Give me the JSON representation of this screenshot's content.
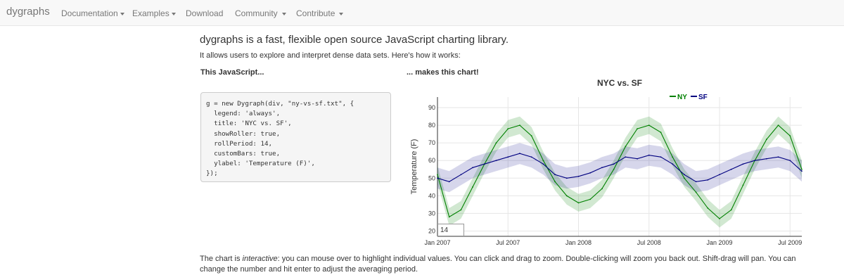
{
  "nav": {
    "brand": "dygraphs",
    "items": [
      {
        "label": "Documentation",
        "caret": true
      },
      {
        "label": "Examples",
        "caret": true
      },
      {
        "label": "Download",
        "caret": false
      },
      {
        "label": "Community",
        "caret": true
      },
      {
        "label": "Contribute",
        "caret": true
      }
    ]
  },
  "content": {
    "intro": "dygraphs is a fast, flexible open source JavaScript charting library.",
    "lead": "It allows users to explore and interpret dense data sets. Here's how it works:",
    "left_heading": "This JavaScript...",
    "right_heading": "... makes this chart!",
    "code": "g = new Dygraph(div, \"ny-vs-sf.txt\", {\n  legend: 'always',\n  title: 'NYC vs. SF',\n  showRoller: true,\n  rollPeriod: 14,\n  customBars: true,\n  ylabel: 'Temperature (F)',\n});",
    "description_pre": "The chart is ",
    "description_em": "interactive",
    "description_post": ": you can mouse over to highlight individual values. You can click and drag to zoom. Double-clicking will zoom you back out. Shift-drag will pan. You can change the number and hit enter to adjust the averaging period."
  },
  "roller_value": "14",
  "colors": {
    "ny": "#008000",
    "sf": "#000080"
  },
  "chart_data": {
    "type": "line",
    "title": "NYC vs. SF",
    "ylabel": "Temperature (F)",
    "xlabel": "",
    "ylim": [
      17,
      96
    ],
    "yticks": [
      20,
      30,
      40,
      50,
      60,
      70,
      80,
      90
    ],
    "xlim_months": [
      0,
      31
    ],
    "xticks": [
      {
        "label": "Jan 2007",
        "month": 0
      },
      {
        "label": "Jul 2007",
        "month": 6
      },
      {
        "label": "Jan 2008",
        "month": 12
      },
      {
        "label": "Jul 2008",
        "month": 18
      },
      {
        "label": "Jan 2009",
        "month": 24
      },
      {
        "label": "Jul 2009",
        "month": 30
      }
    ],
    "grid": true,
    "legend": "top-right",
    "series": [
      {
        "name": "NY",
        "color": "#008000",
        "x": [
          0,
          1,
          2,
          3,
          4,
          5,
          6,
          7,
          8,
          9,
          10,
          11,
          12,
          13,
          14,
          15,
          16,
          17,
          18,
          19,
          20,
          21,
          22,
          23,
          24,
          25,
          26,
          27,
          28,
          29,
          30,
          31
        ],
        "values": [
          52,
          28,
          32,
          45,
          58,
          70,
          78,
          80,
          74,
          60,
          48,
          40,
          36,
          38,
          44,
          55,
          68,
          78,
          80,
          76,
          62,
          50,
          42,
          33,
          27,
          32,
          46,
          60,
          72,
          80,
          74,
          55
        ],
        "low": [
          47,
          23,
          27,
          40,
          53,
          65,
          73,
          75,
          69,
          55,
          43,
          35,
          31,
          33,
          39,
          50,
          63,
          73,
          75,
          71,
          57,
          45,
          37,
          28,
          22,
          27,
          41,
          55,
          67,
          75,
          69,
          50
        ],
        "high": [
          57,
          33,
          37,
          50,
          63,
          75,
          83,
          85,
          79,
          65,
          53,
          45,
          41,
          43,
          49,
          60,
          73,
          83,
          85,
          81,
          67,
          55,
          47,
          38,
          32,
          37,
          51,
          65,
          77,
          85,
          79,
          60
        ]
      },
      {
        "name": "SF",
        "color": "#000080",
        "x": [
          0,
          1,
          2,
          3,
          4,
          5,
          6,
          7,
          8,
          9,
          10,
          11,
          12,
          13,
          14,
          15,
          16,
          17,
          18,
          19,
          20,
          21,
          22,
          23,
          24,
          25,
          26,
          27,
          28,
          29,
          30,
          31
        ],
        "values": [
          50,
          48,
          52,
          56,
          58,
          60,
          62,
          64,
          62,
          58,
          52,
          50,
          51,
          53,
          56,
          58,
          62,
          61,
          63,
          62,
          58,
          52,
          48,
          49,
          52,
          55,
          58,
          60,
          61,
          62,
          60,
          54
        ],
        "low": [
          44,
          42,
          46,
          50,
          52,
          54,
          56,
          58,
          56,
          52,
          46,
          44,
          45,
          47,
          50,
          52,
          56,
          55,
          57,
          56,
          52,
          46,
          42,
          43,
          46,
          49,
          52,
          54,
          55,
          56,
          54,
          48
        ],
        "high": [
          56,
          54,
          58,
          62,
          64,
          66,
          68,
          70,
          68,
          64,
          58,
          56,
          57,
          59,
          62,
          64,
          68,
          67,
          69,
          68,
          64,
          58,
          54,
          55,
          58,
          61,
          64,
          66,
          67,
          68,
          66,
          60
        ]
      }
    ]
  }
}
